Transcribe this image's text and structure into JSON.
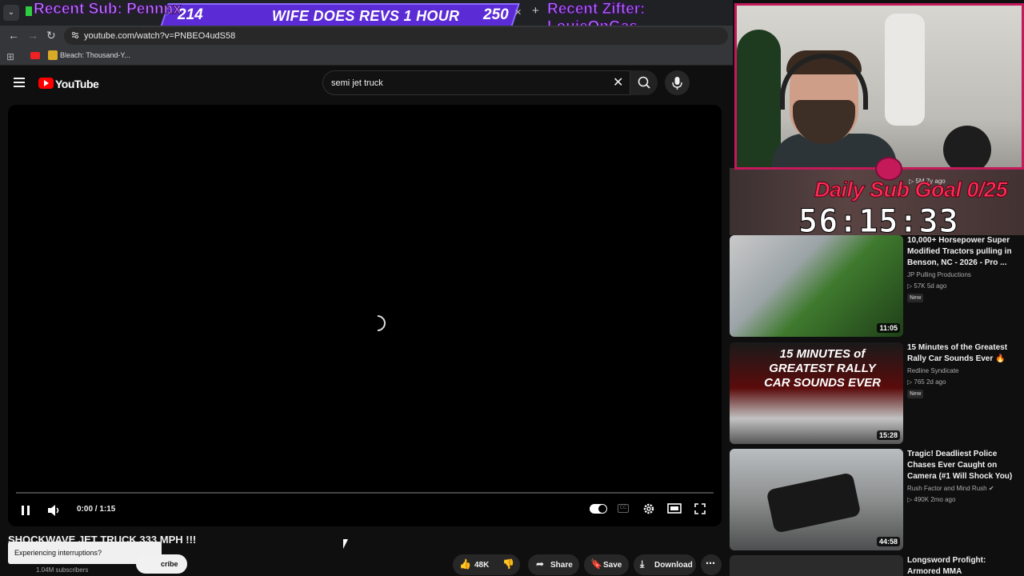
{
  "browser": {
    "url": "youtube.com/watch?v=PNBEO4udS58",
    "bookmark_label": "Bleach: Thousand-Y..."
  },
  "overlay": {
    "recent_sub": "Recent Sub: Pennnx",
    "recent_zifter": "Recent Zifter: LouieOnGas",
    "goal_current": "214",
    "goal_title": "WIFE DOES REVS 1 HOUR",
    "goal_target": "250",
    "sub_goal": "Daily Sub Goal 0/25",
    "timer": "56:15:33",
    "goal_meta": "▷ 5M  7y ago"
  },
  "header": {
    "logo_text": "YouTube",
    "search_value": "semi jet truck"
  },
  "player": {
    "time": "0:00 / 1:15",
    "progress": 0.0
  },
  "video": {
    "title": "SHOCKWAVE JET TRUCK 333 MPH !!!",
    "subscribers": "1.04M subscribers",
    "subscribe_label": "cribe",
    "interruption_text": "Experiencing interruptions?",
    "likes": "48K",
    "share_label": "Share",
    "save_label": "Save",
    "download_label": "Download"
  },
  "recommendations": [
    {
      "title": "10,000+ Horsepower Super Modified Tractors pulling in Benson, NC - 2026 - Pro ...",
      "channel": "JP Pulling Productions",
      "meta": "▷ 57K  5d ago",
      "badge": "New",
      "duration": "11:05",
      "thumb_color": "#3f7a2e"
    },
    {
      "title": "15 Minutes of the Greatest Rally Car Sounds Ever 🔥",
      "channel": "Redline Syndicate",
      "meta": "▷ 765  2d ago",
      "badge": "New",
      "duration": "15:28",
      "thumb_color": "#8a1010",
      "thumb_text": "15 MINUTES of GREATEST RALLY CAR SOUNDS EVER"
    },
    {
      "title": "Tragic! Deadliest Police Chases Ever Caught on Camera (#1 Will Shock You)",
      "channel": "Rush Factor and Mind Rush ✔",
      "meta": "▷ 490K  2mo ago",
      "badge": "",
      "duration": "44:58",
      "thumb_color": "#8d8f8f"
    },
    {
      "title": "Longsword Profight: Armored MMA",
      "channel": "",
      "meta": "",
      "badge": "",
      "duration": "",
      "thumb_color": "#2b2b2b"
    }
  ]
}
